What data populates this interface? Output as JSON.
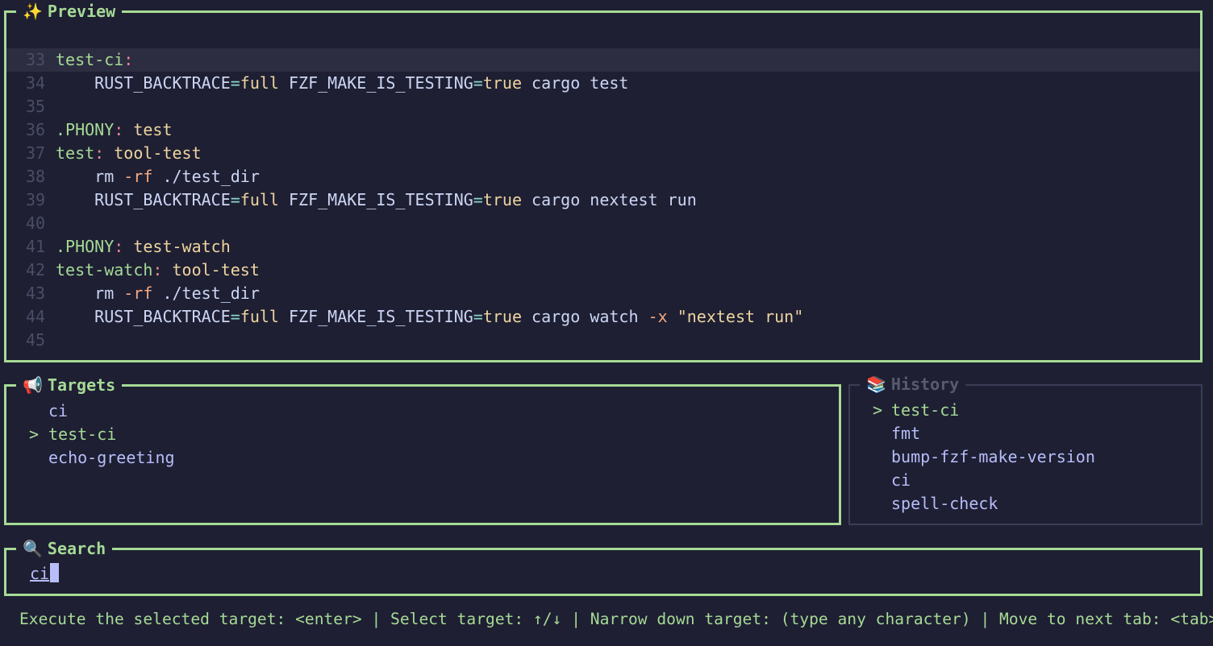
{
  "preview": {
    "icon": "✨",
    "title": "Preview",
    "lines": [
      {
        "n": "33",
        "highlight": true,
        "parts": [
          {
            "c": "t-target",
            "t": "test-ci"
          },
          {
            "c": "t-colon",
            "t": ":"
          }
        ]
      },
      {
        "n": "34",
        "parts": [
          {
            "c": "",
            "t": "    RUST_BACKTRACE"
          },
          {
            "c": "t-eq",
            "t": "="
          },
          {
            "c": "t-val",
            "t": "full"
          },
          {
            "c": "",
            "t": " FZF_MAKE_IS_TESTING"
          },
          {
            "c": "t-eq",
            "t": "="
          },
          {
            "c": "t-val",
            "t": "true"
          },
          {
            "c": "",
            "t": " cargo test"
          }
        ]
      },
      {
        "n": "35",
        "parts": []
      },
      {
        "n": "36",
        "parts": [
          {
            "c": "t-target",
            "t": ".PHONY"
          },
          {
            "c": "t-colon",
            "t": ":"
          },
          {
            "c": "t-prereq",
            "t": " test"
          }
        ]
      },
      {
        "n": "37",
        "parts": [
          {
            "c": "t-target",
            "t": "test"
          },
          {
            "c": "t-colon",
            "t": ":"
          },
          {
            "c": "t-prereq",
            "t": " tool-test"
          }
        ]
      },
      {
        "n": "38",
        "parts": [
          {
            "c": "",
            "t": "    rm "
          },
          {
            "c": "t-flag",
            "t": "-rf"
          },
          {
            "c": "",
            "t": " ./test_dir"
          }
        ]
      },
      {
        "n": "39",
        "parts": [
          {
            "c": "",
            "t": "    RUST_BACKTRACE"
          },
          {
            "c": "t-eq",
            "t": "="
          },
          {
            "c": "t-val",
            "t": "full"
          },
          {
            "c": "",
            "t": " FZF_MAKE_IS_TESTING"
          },
          {
            "c": "t-eq",
            "t": "="
          },
          {
            "c": "t-val",
            "t": "true"
          },
          {
            "c": "",
            "t": " cargo nextest run"
          }
        ]
      },
      {
        "n": "40",
        "parts": []
      },
      {
        "n": "41",
        "parts": [
          {
            "c": "t-target",
            "t": ".PHONY"
          },
          {
            "c": "t-colon",
            "t": ":"
          },
          {
            "c": "t-prereq",
            "t": " test-watch"
          }
        ]
      },
      {
        "n": "42",
        "parts": [
          {
            "c": "t-target",
            "t": "test-watch"
          },
          {
            "c": "t-colon",
            "t": ":"
          },
          {
            "c": "t-prereq",
            "t": " tool-test"
          }
        ]
      },
      {
        "n": "43",
        "parts": [
          {
            "c": "",
            "t": "    rm "
          },
          {
            "c": "t-flag",
            "t": "-rf"
          },
          {
            "c": "",
            "t": " ./test_dir"
          }
        ]
      },
      {
        "n": "44",
        "parts": [
          {
            "c": "",
            "t": "    RUST_BACKTRACE"
          },
          {
            "c": "t-eq",
            "t": "="
          },
          {
            "c": "t-val",
            "t": "full"
          },
          {
            "c": "",
            "t": " FZF_MAKE_IS_TESTING"
          },
          {
            "c": "t-eq",
            "t": "="
          },
          {
            "c": "t-val",
            "t": "true"
          },
          {
            "c": "",
            "t": " cargo watch "
          },
          {
            "c": "t-flag",
            "t": "-x"
          },
          {
            "c": "",
            "t": " "
          },
          {
            "c": "t-str",
            "t": "\"nextest run\""
          }
        ]
      },
      {
        "n": "45",
        "parts": []
      }
    ]
  },
  "targets": {
    "icon": "📢",
    "title": "Targets",
    "items": [
      {
        "label": "ci",
        "selected": false
      },
      {
        "label": "test-ci",
        "selected": true
      },
      {
        "label": "echo-greeting",
        "selected": false
      }
    ]
  },
  "history": {
    "icon": "📚",
    "title": "History",
    "items": [
      {
        "label": "test-ci",
        "selected": true
      },
      {
        "label": "fmt",
        "selected": false
      },
      {
        "label": "bump-fzf-make-version",
        "selected": false
      },
      {
        "label": "ci",
        "selected": false
      },
      {
        "label": "spell-check",
        "selected": false
      }
    ]
  },
  "selection_caret": ">",
  "search": {
    "icon": "🔍",
    "title": "Search",
    "value": "ci"
  },
  "footer": {
    "help": "Execute the selected target: <enter> | Select target: ↑/↓ | Narrow down target: (type any character) | Move to next tab: <tab>"
  }
}
